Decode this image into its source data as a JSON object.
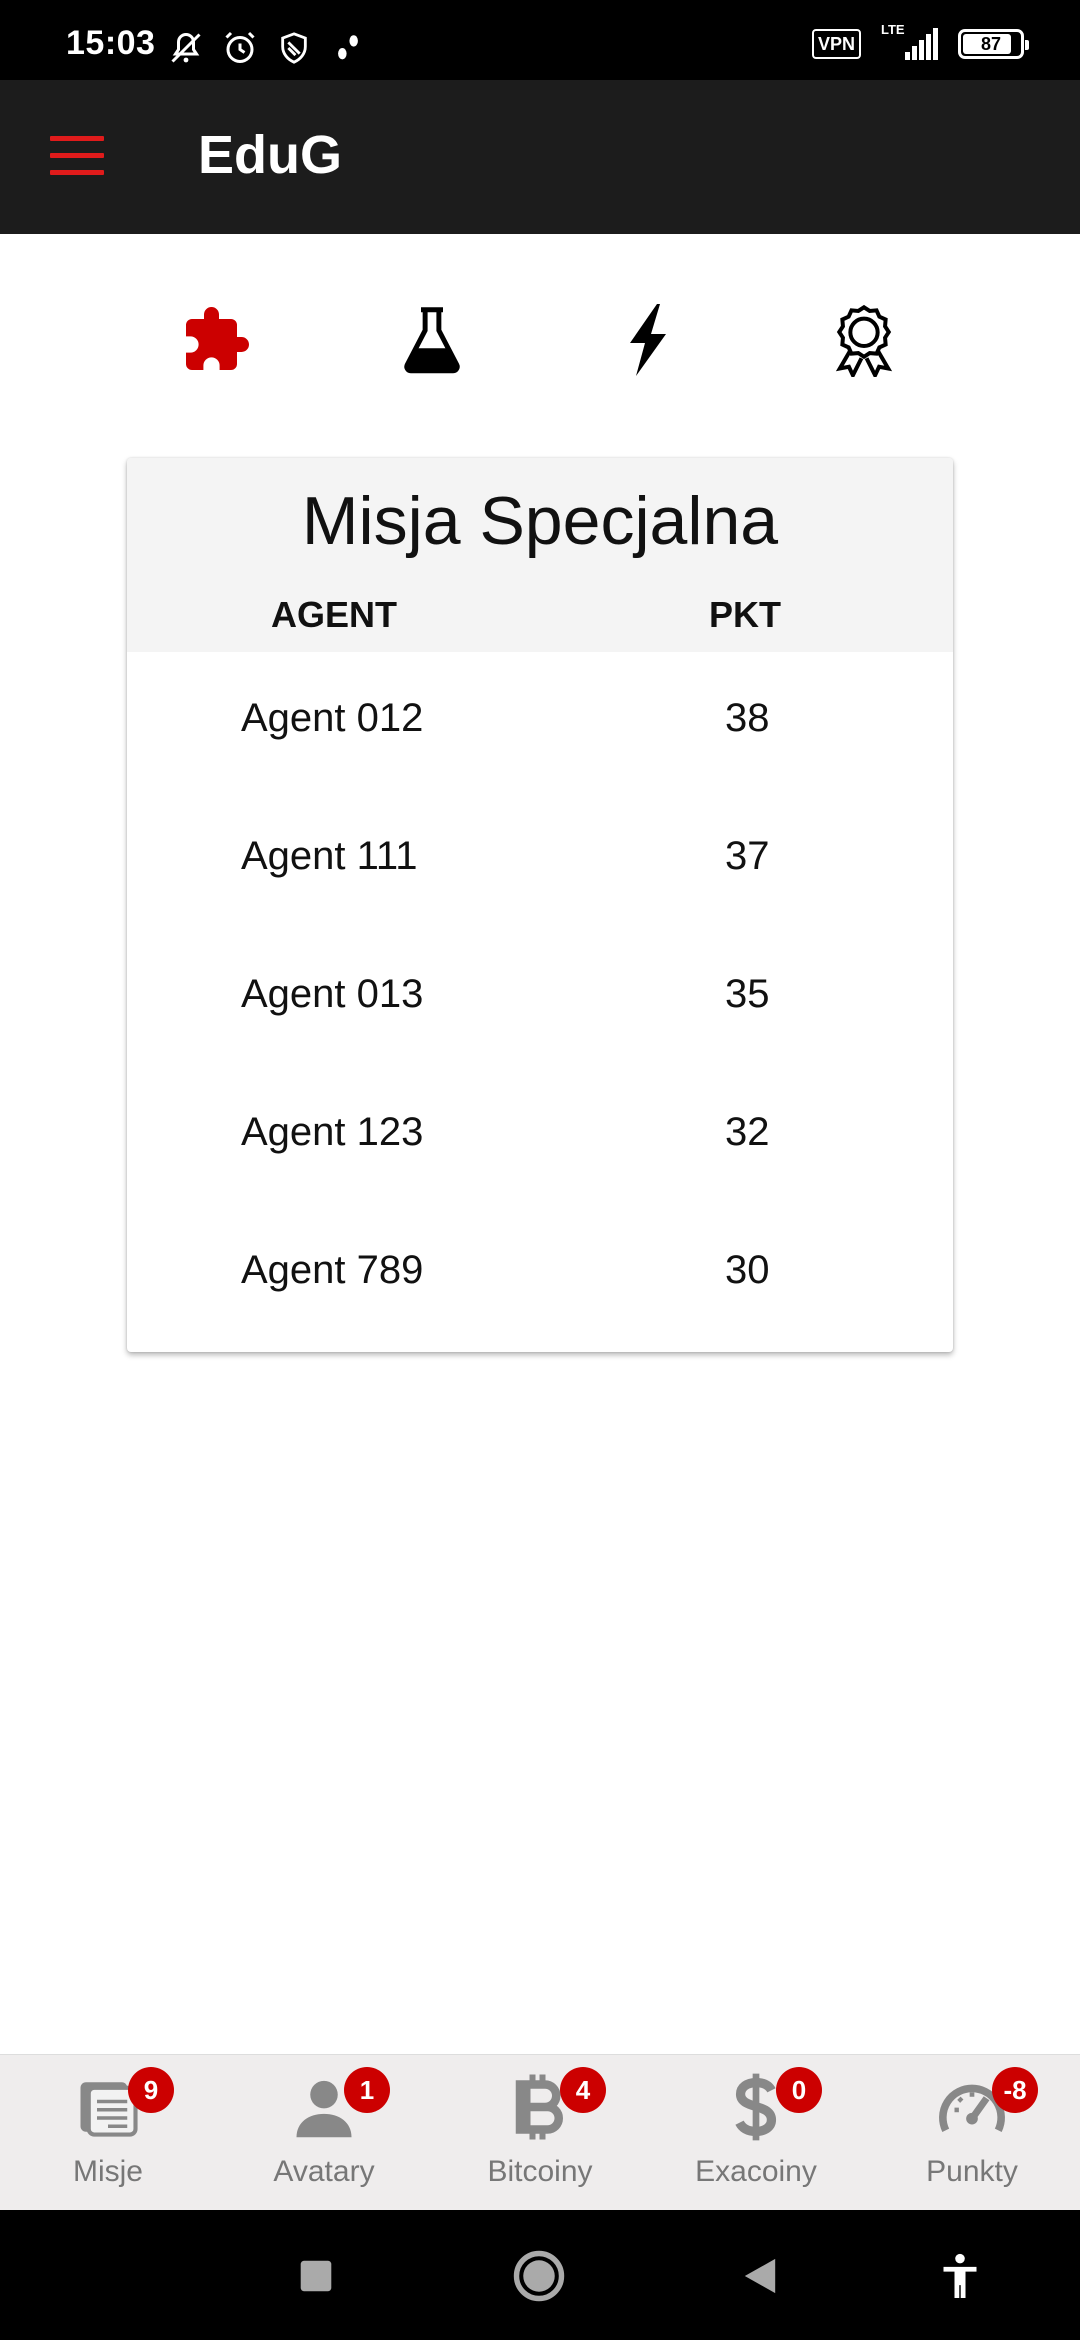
{
  "status_bar": {
    "time": "15:03",
    "vpn": "VPN",
    "network": "LTE",
    "battery": "87",
    "battery_level": 0.87
  },
  "app_bar": {
    "title": "EduG",
    "menu_icon": "hamburger-menu-icon",
    "accent_color": "#e01b1b"
  },
  "categories": [
    {
      "icon": "puzzle-icon",
      "active": true
    },
    {
      "icon": "flask-icon",
      "active": false
    },
    {
      "icon": "lightning-icon",
      "active": false
    },
    {
      "icon": "award-ribbon-icon",
      "active": false
    }
  ],
  "leaderboard": {
    "title": "Misja Specjalna",
    "columns": {
      "agent": "AGENT",
      "points": "PKT"
    },
    "rows": [
      {
        "agent": "Agent 012",
        "points": "38"
      },
      {
        "agent": "Agent 111",
        "points": "37"
      },
      {
        "agent": "Agent 013",
        "points": "35"
      },
      {
        "agent": "Agent 123",
        "points": "32"
      },
      {
        "agent": "Agent 789",
        "points": "30"
      }
    ]
  },
  "bottom_nav": [
    {
      "label": "Misje",
      "badge": "9",
      "icon": "document-icon"
    },
    {
      "label": "Avatary",
      "badge": "1",
      "icon": "person-icon"
    },
    {
      "label": "Bitcoiny",
      "badge": "4",
      "icon": "bitcoin-icon"
    },
    {
      "label": "Exacoiny",
      "badge": "0",
      "icon": "dollar-icon"
    },
    {
      "label": "Punkty",
      "badge": "-8",
      "icon": "speedometer-icon"
    }
  ],
  "badge_color": "#cc0000"
}
